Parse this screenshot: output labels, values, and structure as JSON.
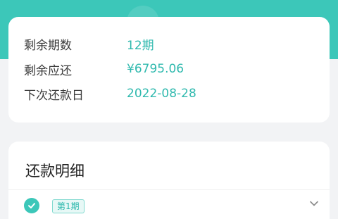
{
  "summary": {
    "remaining_periods_label": "剩余期数",
    "remaining_periods_value": "12期",
    "remaining_amount_label": "剩余应还",
    "remaining_amount_value": "¥6795.06",
    "next_due_label": "下次还款日",
    "next_due_value": "2022-08-28"
  },
  "details": {
    "title": "还款明细",
    "periods": [
      {
        "tag": "第1期",
        "checked": true
      }
    ]
  },
  "colors": {
    "accent": "#3cc7b9",
    "accent_text": "#2fb9ae",
    "background": "#f2f3f5"
  }
}
